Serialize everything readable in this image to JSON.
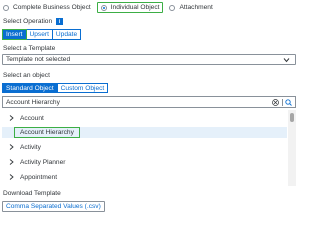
{
  "operation_mode": {
    "options": [
      {
        "label": "Complete Business Object",
        "selected": false
      },
      {
        "label": "Individual Object",
        "selected": true
      },
      {
        "label": "Attachment",
        "selected": false
      }
    ]
  },
  "select_operation": {
    "label": "Select Operation",
    "info": "i",
    "buttons": [
      "Insert",
      "Upsert",
      "Update"
    ],
    "active": "Insert"
  },
  "template": {
    "label": "Select a Template",
    "value": "Template not selected"
  },
  "object": {
    "label": "Select an object",
    "tabs": [
      "Standard Object",
      "Custom Object"
    ],
    "active_tab": "Standard Object",
    "search_value": "Account Hierarchy",
    "items": [
      {
        "label": "Account",
        "expandable": true
      },
      {
        "label": "Account Hierarchy",
        "expandable": false,
        "selected": true
      },
      {
        "label": "Activity",
        "expandable": true
      },
      {
        "label": "Activity Planner",
        "expandable": true
      },
      {
        "label": "Appointment",
        "expandable": true
      }
    ]
  },
  "download": {
    "label": "Download Template",
    "button": "Comma Separated Values (.csv)"
  },
  "colors": {
    "accent": "#0a6ed1",
    "highlight": "#3cae45",
    "selected_row": "#e5f0fa"
  }
}
